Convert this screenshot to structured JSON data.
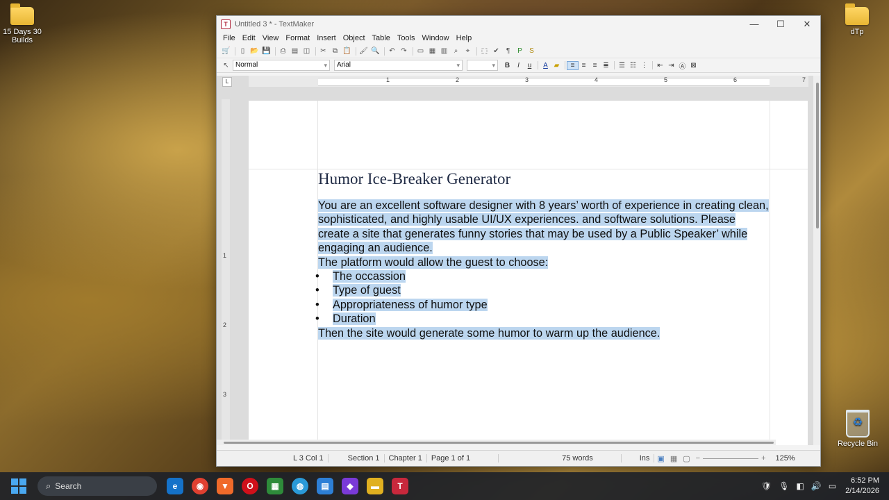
{
  "desktop": {
    "icons": [
      {
        "label_lines": [
          "15 Days 30",
          "Builds"
        ]
      },
      {
        "label_lines": [
          "dTp"
        ]
      },
      {
        "label_lines": [
          "Recycle Bin"
        ]
      }
    ]
  },
  "window": {
    "title": "Untitled 3 * - TextMaker",
    "app_icon": "T",
    "controls": {
      "minimize": "—",
      "maximize": "☐",
      "close": "✕"
    }
  },
  "menu": [
    "File",
    "Edit",
    "View",
    "Format",
    "Insert",
    "Object",
    "Table",
    "Tools",
    "Window",
    "Help"
  ],
  "formatbar": {
    "style": "Normal",
    "font": "Arial",
    "size": "",
    "bold": "B",
    "italic": "I",
    "underline": "u"
  },
  "ruler": {
    "tab_marker": "L",
    "numbers": [
      "1",
      "2",
      "3",
      "4",
      "5",
      "6",
      "7"
    ],
    "vertical_numbers": [
      "1",
      "2",
      "3"
    ]
  },
  "document": {
    "title": "Humor Ice-Breaker Generator",
    "paragraph_1": "You are an excellent software designer with 8 years’ worth of experience in creating clean, sophisticated, and highly usable UI/UX experiences. and software solutions. Please create a site that generates funny stories that may be used by a Public Speaker’ while engaging an audience.",
    "paragraph_2": "The platform would allow the guest to choose:",
    "bullets": [
      "The occassion",
      "Type of guest",
      "Appropriateness of humor type",
      "Duration"
    ],
    "paragraph_3": "Then the site would generate some humor to warm up the audience."
  },
  "statusbar": {
    "position": "L 3 Col 1",
    "section": "Section 1",
    "chapter": "Chapter 1",
    "page": "Page 1 of 1",
    "words": "75 words",
    "mode": "Ins",
    "zoom": "125%"
  },
  "taskbar": {
    "search_placeholder": "Search",
    "time": "6:52 PM",
    "date": "2/14/2026"
  }
}
